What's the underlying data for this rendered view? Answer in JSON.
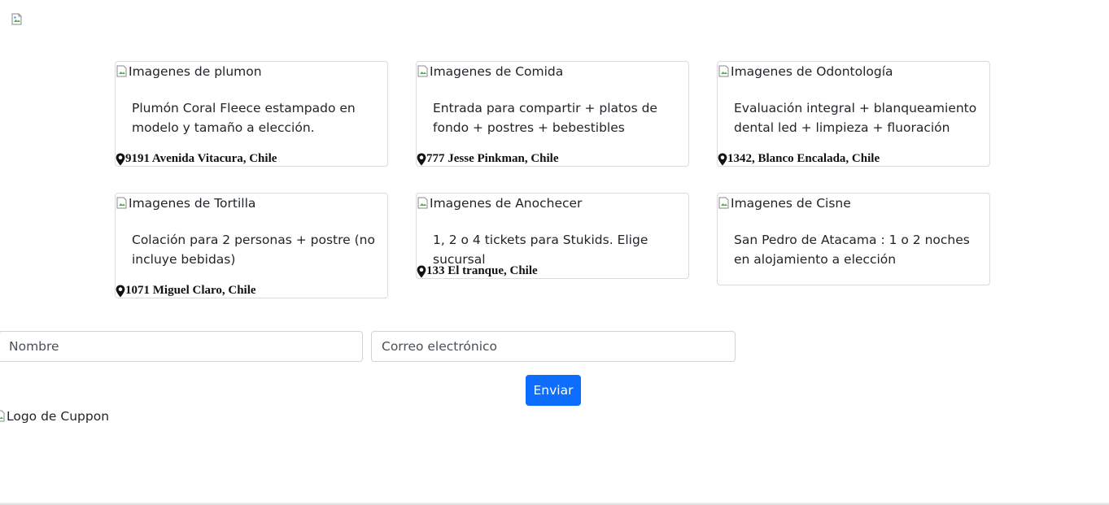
{
  "cards": [
    {
      "img_alt": "Imagenes de plumon",
      "description": "Plumón Coral Fleece estampado en modelo y tamaño a elección.",
      "location": "9191 Avenida Vitacura, Chile"
    },
    {
      "img_alt": "Imagenes de Comida",
      "description": "Entrada para compartir + platos de fondo + postres + bebestibles",
      "location": "777 Jesse Pinkman, Chile"
    },
    {
      "img_alt": "Imagenes de Odontología",
      "description": "Evaluación integral + blanqueamiento dental led + limpieza + fluoración",
      "location": "1342, Blanco Encalada, Chile"
    },
    {
      "img_alt": "Imagenes de Tortilla",
      "description": "Colación para 2 personas + postre (no incluye bebidas)",
      "location": "1071 Miguel Claro, Chile"
    },
    {
      "img_alt": "Imagenes de Anochecer",
      "description": "1, 2 o 4 tickets para Stukids. Elige sucursal",
      "location": "133 El tranque, Chile"
    },
    {
      "img_alt": "Imagenes de Cisne",
      "description": "San Pedro de Atacama : 1 o 2 noches en alojamiento a elección",
      "location": ""
    }
  ],
  "form": {
    "name_placeholder": "Nombre",
    "email_placeholder": "Correo electrónico",
    "submit_label": "Enviar"
  },
  "footer": {
    "logo_alt": "Logo de Cuppon"
  },
  "colors": {
    "primary_button": "#0d6efd"
  }
}
